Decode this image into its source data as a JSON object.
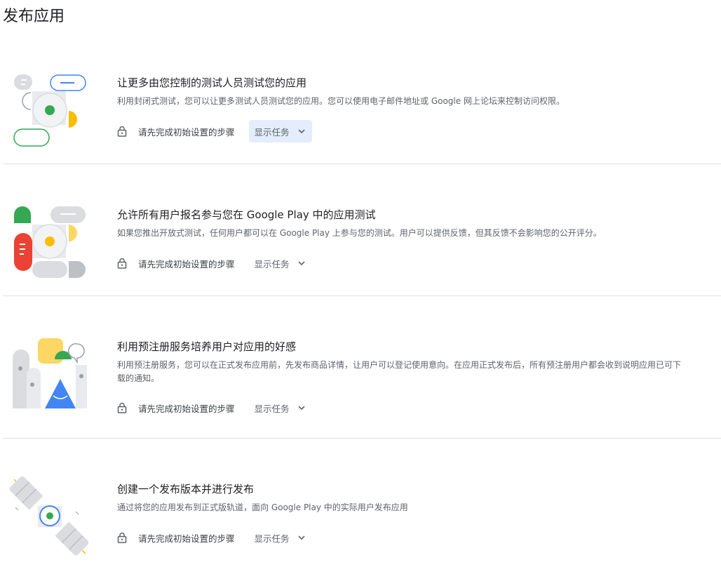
{
  "page": {
    "title": "发布应用"
  },
  "sections": [
    {
      "title": "让更多由您控制的测试人员测试您的应用",
      "description": "利用封闭式测试，您可以让更多测试人员测试您的应用。您可以使用电子邮件地址或 Google 网上论坛来控制访问权限。",
      "locked_label": "请先完成初始设置的步骤",
      "show_tasks_label": "显示任务",
      "illustration_icon": "closed-testing-illustration"
    },
    {
      "title": "允许所有用户报名参与您在 Google Play 中的应用测试",
      "description": "如果您推出开放式测试，任何用户都可以在 Google Play 上参与您的测试。用户可以提供反馈，但其反馈不会影响您的公开评分。",
      "locked_label": "请先完成初始设置的步骤",
      "show_tasks_label": "显示任务",
      "illustration_icon": "open-testing-illustration"
    },
    {
      "title": "利用预注册服务培养用户对应用的好感",
      "description": "利用预注册服务，您可以在正式发布应用前，先发布商品详情，让用户可以登记使用意向。在应用正式发布后，所有预注册用户都会收到说明应用已可下载的通知。",
      "locked_label": "请先完成初始设置的步骤",
      "show_tasks_label": "显示任务",
      "illustration_icon": "pre-registration-illustration"
    },
    {
      "title": "创建一个发布版本并进行发布",
      "description": "通过将您的应用发布到正式版轨道，面向 Google Play 中的实际用户发布应用",
      "locked_label": "请先完成初始设置的步骤",
      "show_tasks_label": "显示任务",
      "illustration_icon": "production-release-illustration"
    }
  ],
  "colors": {
    "green": "#34a853",
    "yellow": "#fbbc04",
    "blue": "#4285f4",
    "red": "#ea4335",
    "grey": "#dadce0",
    "active_button_bg": "#e3edfb"
  }
}
